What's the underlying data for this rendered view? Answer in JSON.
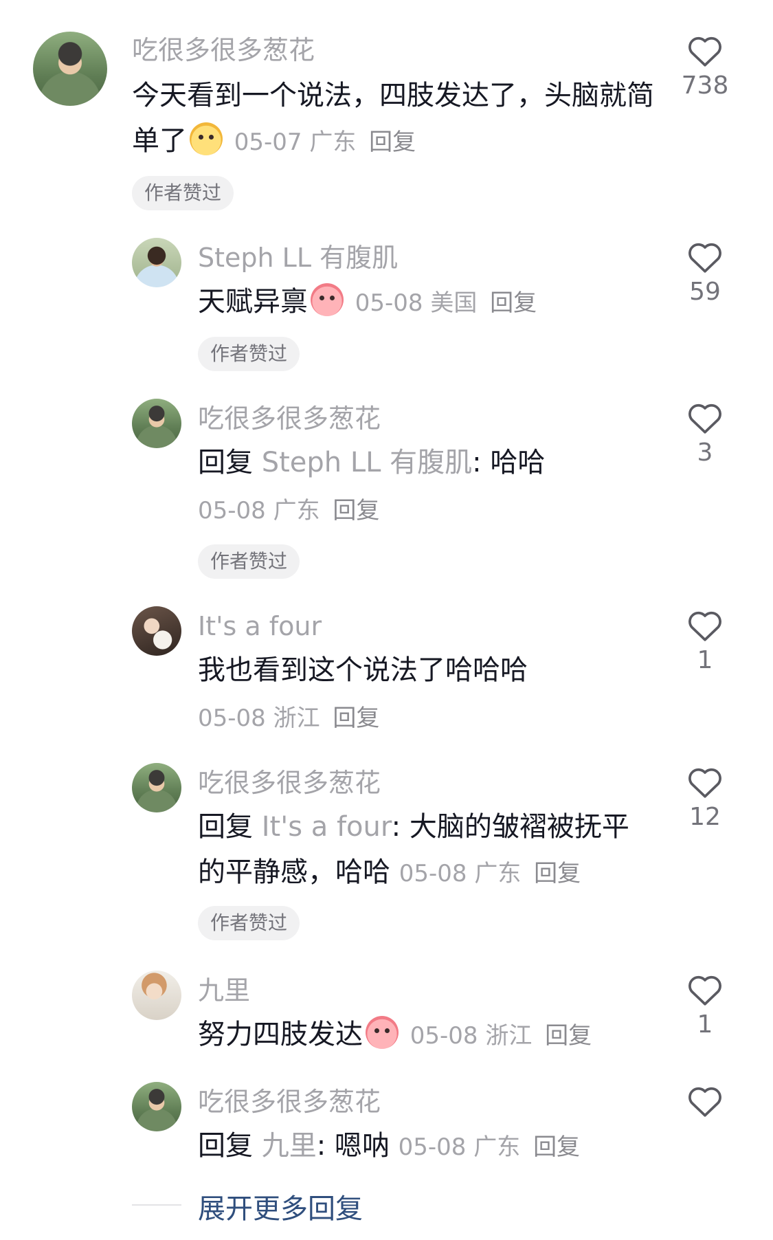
{
  "comments": [
    {
      "username": "吃很多很多葱花",
      "text": "今天看到一个说法，四肢发达了，头脑就简单了",
      "date": "05-07",
      "location": "广东",
      "reply": "回复",
      "likes": "738",
      "author_liked": "作者赞过",
      "emoji": "yellow-face-emoji"
    },
    {
      "username": "Steph LL 有腹肌",
      "text": "天赋异禀",
      "date": "05-08",
      "location": "美国",
      "reply": "回复",
      "likes": "59",
      "author_liked": "作者赞过",
      "emoji": "crying-face-emoji"
    },
    {
      "username": "吃很多很多葱花",
      "reply_prefix": "回复",
      "reply_target": "Steph LL 有腹肌",
      "text": "哈哈",
      "date": "05-08",
      "location": "广东",
      "reply": "回复",
      "likes": "3",
      "author_liked": "作者赞过"
    },
    {
      "username": "It's a four",
      "text": "我也看到这个说法了哈哈哈",
      "date": "05-08",
      "location": "浙江",
      "reply": "回复",
      "likes": "1"
    },
    {
      "username": "吃很多很多葱花",
      "reply_prefix": "回复",
      "reply_target": "It's a four",
      "text_line1": "大脑的皱褶被抚平",
      "text_line2": "的平静感，哈哈",
      "date": "05-08",
      "location": "广东",
      "reply": "回复",
      "likes": "12",
      "author_liked": "作者赞过"
    },
    {
      "username": "九里",
      "text": "努力四肢发达",
      "date": "05-08",
      "location": "浙江",
      "reply": "回复",
      "likes": "1",
      "emoji": "shocked-face-emoji"
    },
    {
      "username": "吃很多很多葱花",
      "reply_prefix": "回复",
      "reply_target": "九里",
      "text": "嗯呐",
      "date": "05-08",
      "location": "广东",
      "reply": "回复",
      "likes": ""
    }
  ],
  "expand_more": "展开更多回复",
  "colors": {
    "text": "#161823",
    "muted": "#a4a4a9",
    "link": "#2f4e7d",
    "badge_bg": "#f1f1f2"
  }
}
